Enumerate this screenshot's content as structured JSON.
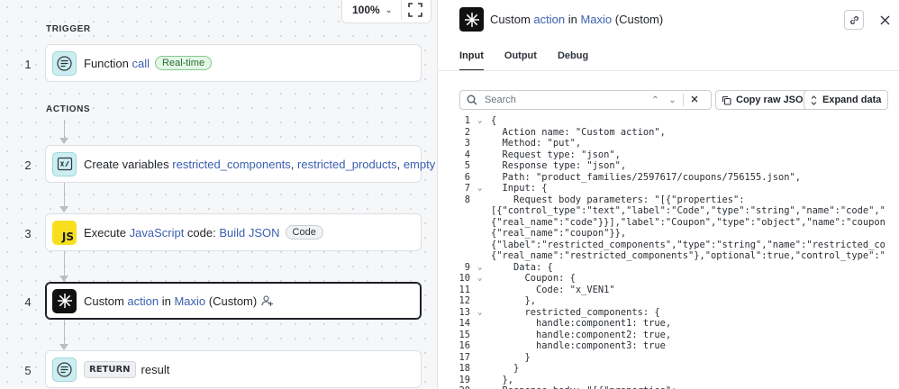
{
  "canvas": {
    "zoom_level": "100%",
    "trigger_label": "TRIGGER",
    "actions_label": "ACTIONS",
    "steps": [
      {
        "num": "1",
        "parts": [
          "Function",
          " ",
          "call"
        ],
        "badge": "Real-time"
      },
      {
        "num": "2",
        "parts": [
          "Create variables",
          " ",
          "restricted_components",
          ", ",
          "restricted_products",
          ", ",
          "empty"
        ]
      },
      {
        "num": "3",
        "parts": [
          "Execute",
          " ",
          "JavaScript",
          " code: ",
          "Build JSON"
        ],
        "badge": "Code",
        "icon_text": "JS"
      },
      {
        "num": "4",
        "parts": [
          "Custom",
          " ",
          "action",
          " in ",
          "Maxio",
          " (Custom)"
        ]
      },
      {
        "num": "5",
        "tag": "RETURN",
        "parts": [
          "result"
        ]
      }
    ]
  },
  "panel": {
    "title_parts": [
      "Custom",
      " ",
      "action",
      " in ",
      "Maxio",
      " (Custom)"
    ],
    "tabs": [
      "Input",
      "Output",
      "Debug"
    ],
    "active_tab": "Input",
    "search_placeholder": "Search",
    "copy_raw_json": "Copy raw JSON",
    "expand_data": "Expand data",
    "code_lines": [
      {
        "n": "1",
        "fold": true,
        "text": "{"
      },
      {
        "n": "2",
        "text": "  Action name: \"Custom action\","
      },
      {
        "n": "3",
        "text": "  Method: \"put\","
      },
      {
        "n": "4",
        "text": "  Request type: \"json\","
      },
      {
        "n": "5",
        "text": "  Response type: \"json\","
      },
      {
        "n": "6",
        "text": "  Path: \"product_families/2597617/coupons/756155.json\","
      },
      {
        "n": "7",
        "fold": true,
        "text": "  Input: {"
      },
      {
        "n": "8",
        "text": "    Request body parameters: \"[{\"properties\":"
      },
      {
        "n": "",
        "text": "[{\"control_type\":\"text\",\"label\":\"Code\",\"type\":\"string\",\"name\":\"code\",\""
      },
      {
        "n": "",
        "text": "{\"real_name\":\"code\"}}],\"label\":\"Coupon\",\"type\":\"object\",\"name\":\"coupon"
      },
      {
        "n": "",
        "text": "{\"real_name\":\"coupon\"}},"
      },
      {
        "n": "",
        "text": "{\"label\":\"restricted_components\",\"type\":\"string\",\"name\":\"restricted_co"
      },
      {
        "n": "",
        "text": "{\"real_name\":\"restricted_components\"},\"optional\":true,\"control_type\":\""
      },
      {
        "n": "9",
        "fold": true,
        "text": "    Data: {"
      },
      {
        "n": "10",
        "fold": true,
        "text": "      Coupon: {"
      },
      {
        "n": "11",
        "text": "        Code: \"x_VEN1\""
      },
      {
        "n": "12",
        "text": "      },"
      },
      {
        "n": "13",
        "fold": true,
        "text": "      restricted_components: {"
      },
      {
        "n": "14",
        "text": "        handle:component1: true,"
      },
      {
        "n": "15",
        "text": "        handle:component2: true,"
      },
      {
        "n": "16",
        "text": "        handle:component3: true"
      },
      {
        "n": "17",
        "text": "      }"
      },
      {
        "n": "18",
        "text": "    }"
      },
      {
        "n": "19",
        "text": "  },"
      },
      {
        "n": "20",
        "text": "  Response body: \"[{\"properties\":"
      }
    ]
  },
  "colors": {
    "link": "#3b5fb0",
    "string": "#1a7d3a",
    "badge_green": "#2a6d35"
  }
}
